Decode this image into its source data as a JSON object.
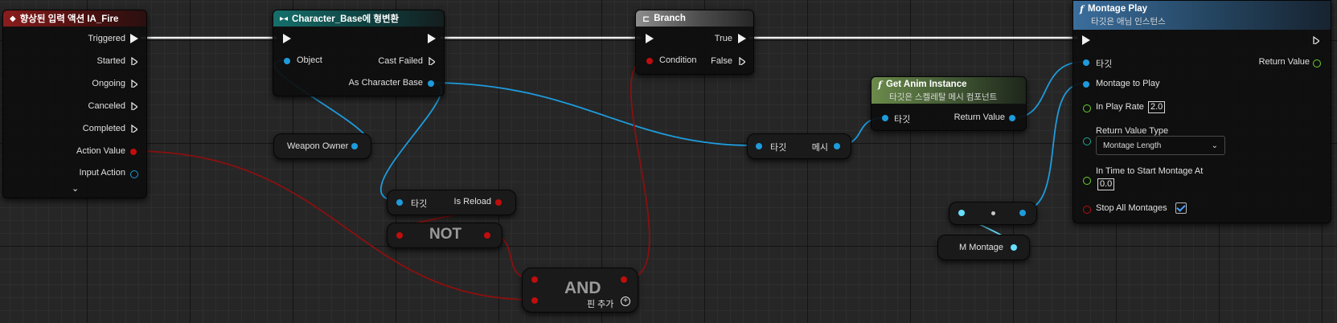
{
  "nodes": {
    "input_action": {
      "title": "향상된 입력 액션 IA_Fire",
      "pins": [
        "Triggered",
        "Started",
        "Ongoing",
        "Canceled",
        "Completed",
        "Action Value",
        "Input Action"
      ]
    },
    "cast": {
      "title": "Character_Base에 형변환",
      "object": "Object",
      "cast_failed": "Cast Failed",
      "as_character_base": "As Character Base"
    },
    "branch": {
      "title": "Branch",
      "true_label": "True",
      "condition": "Condition",
      "false_label": "False"
    },
    "montage_play": {
      "title": "Montage Play",
      "subtitle": "타깃은 애님 인스턴스",
      "target": "타깃",
      "return_value": "Return Value",
      "montage_to_play": "Montage to Play",
      "in_play_rate": "In Play Rate",
      "in_play_rate_value": "2.0",
      "return_value_type": "Return Value Type",
      "return_value_type_option": "Montage Length",
      "in_time_to_start": "In Time to Start Montage At",
      "in_time_to_start_value": "0.0",
      "stop_all_montages": "Stop All Montages",
      "stop_all_montages_checked": true
    },
    "get_anim_instance": {
      "title": "Get Anim Instance",
      "subtitle": "타깃은 스켈레탈 메시 컴포넌트",
      "target": "타깃",
      "return_value": "Return Value"
    },
    "weapon_owner": {
      "label": "Weapon Owner"
    },
    "mesh_getter": {
      "target": "타깃",
      "output": "메시"
    },
    "is_reload": {
      "target": "타깃",
      "output": "Is Reload"
    },
    "not_node": {
      "label": "NOT"
    },
    "and_node": {
      "label": "AND",
      "add_pin": "핀 추가"
    },
    "m_montage": {
      "label": "M Montage"
    }
  },
  "colors": {
    "exec": "#f0f0f0",
    "object": "#1e9bdc",
    "bool": "#c00d0d",
    "float": "#6ad22e",
    "enum": "#1ba899",
    "montage_ref": "#66e0ff",
    "cast_header": "#15706b",
    "event_header": "#8b1d1d",
    "branch_header": "#8c8c8c",
    "function_header": "#3b6e9d",
    "pure_function_header": "#6b8b4b"
  },
  "icons": {
    "event": "diamond-event-icon",
    "cast": "cast-arrow-icon",
    "branch": "branch-icon",
    "function": "function-f-icon",
    "expand": "chevron-down-icon",
    "add_pin": "plus-circle-icon"
  }
}
